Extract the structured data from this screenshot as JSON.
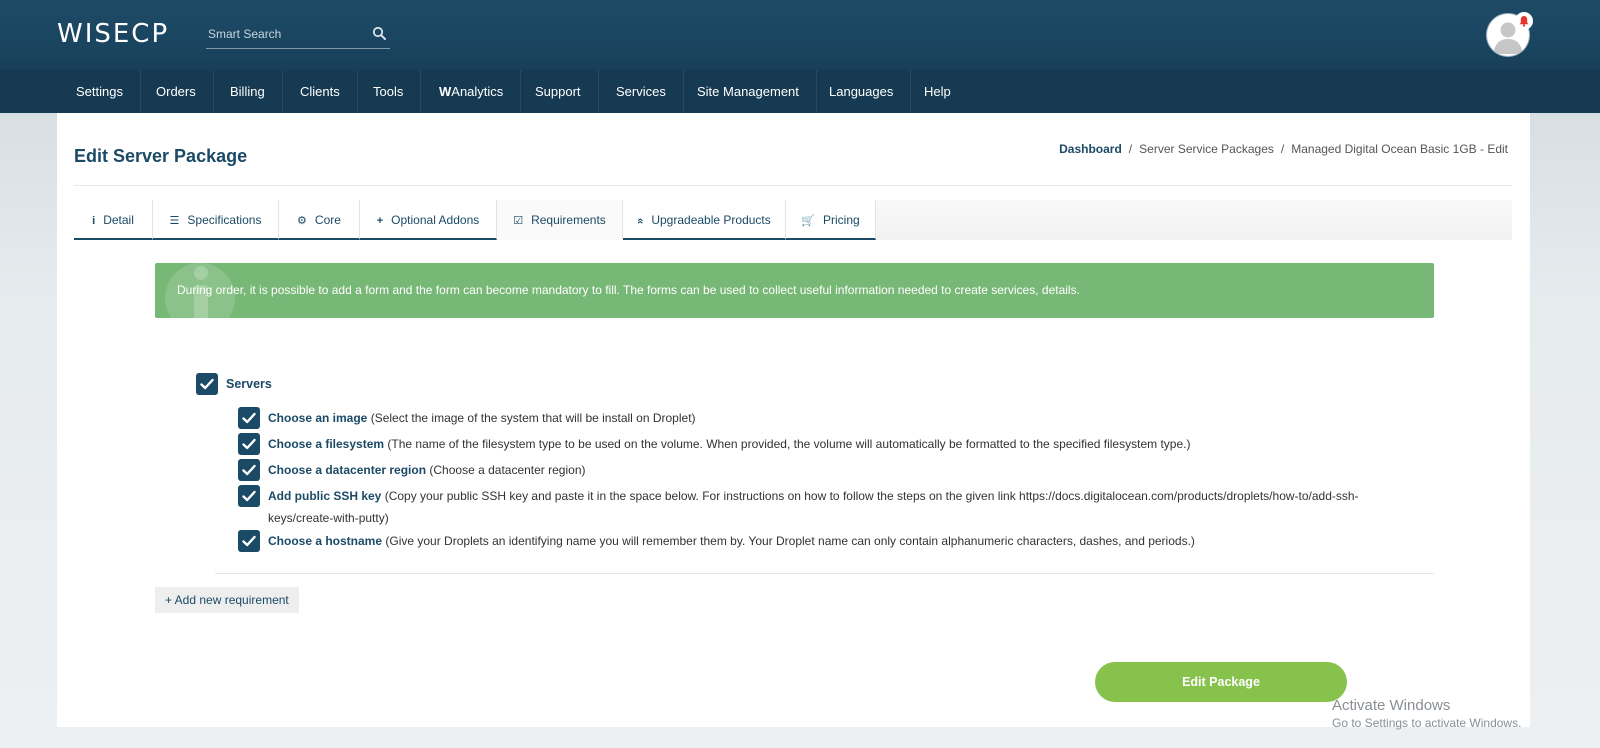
{
  "header": {
    "logo": "WISECP",
    "search_placeholder": "Smart Search"
  },
  "nav": {
    "items": [
      {
        "label": "Settings"
      },
      {
        "label": "Orders"
      },
      {
        "label": "Billing"
      },
      {
        "label": "Clients"
      },
      {
        "label": "Tools"
      },
      {
        "label_bold": "W",
        "label": "Analytics"
      },
      {
        "label": "Support"
      },
      {
        "label": "Services"
      },
      {
        "label": "Site Management"
      },
      {
        "label": "Languages"
      },
      {
        "label": "Help"
      }
    ]
  },
  "page": {
    "title": "Edit Server Package",
    "breadcrumb": [
      "Dashboard",
      "Server Service Packages",
      "Managed Digital Ocean Basic 1GB - Edit"
    ]
  },
  "tabs": [
    {
      "label": "Detail",
      "icon": "info-icon",
      "glyph": "i"
    },
    {
      "label": "Specifications",
      "icon": "list-icon",
      "glyph": "☰"
    },
    {
      "label": "Core",
      "icon": "gears-icon",
      "glyph": "⚙"
    },
    {
      "label": "Optional Addons",
      "icon": "plus-icon",
      "glyph": "+"
    },
    {
      "label": "Requirements",
      "icon": "check-square-icon",
      "glyph": "☑",
      "active": true
    },
    {
      "label": "Upgradeable Products",
      "icon": "angle-double-up-icon",
      "glyph": "«"
    },
    {
      "label": "Pricing",
      "icon": "cart-icon",
      "glyph": "🛒"
    }
  ],
  "alert": {
    "text": "During order, it is possible to add a form and the form can become mandatory to fill. The forms can be used to collect useful information needed to create services, details.",
    "color": "#78b877"
  },
  "requirements": {
    "group": {
      "label": "Servers",
      "checked": true
    },
    "items": [
      {
        "name": "Choose an image",
        "desc": "(Select the image of the system that will be install on Droplet)",
        "checked": true
      },
      {
        "name": "Choose a filesystem",
        "desc": "(The name of the filesystem type to be used on the volume. When provided, the volume will automatically be formatted to the specified filesystem type.)",
        "checked": true
      },
      {
        "name": "Choose a datacenter region",
        "desc": "(Choose a datacenter region)",
        "checked": true
      },
      {
        "name": "Add public SSH key",
        "desc": "(Copy your public SSH key and paste it in the space below. For instructions on how to follow the steps on the given link https://docs.digitalocean.com/products/droplets/how-to/add-ssh-keys/create-with-putty)",
        "checked": true
      },
      {
        "name": "Choose a hostname",
        "desc": "(Give your Droplets an identifying name you will remember them by. Your Droplet name can only contain alphanumeric characters, dashes, and periods.)",
        "checked": true
      }
    ],
    "add_label": "+ Add new requirement"
  },
  "actions": {
    "submit_label": "Edit Package",
    "submit_color": "#86c24c"
  },
  "watermark": {
    "title": "Activate Windows",
    "subtitle": "Go to Settings to activate Windows."
  },
  "colors": {
    "brand_dark": "#1a4a66",
    "nav_bg": "#163a52",
    "checkbox": "#1a4a66"
  }
}
